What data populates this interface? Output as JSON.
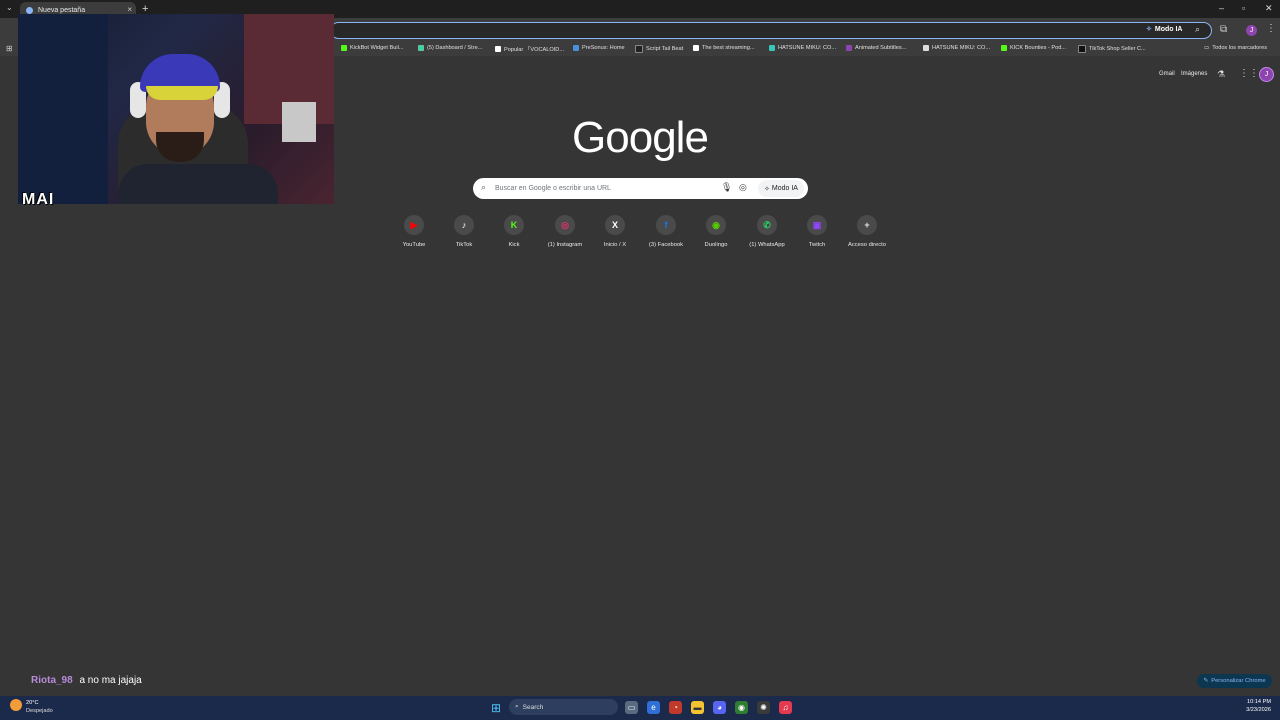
{
  "browser": {
    "tab_title": "Nueva pestaña",
    "new_tab_symbol": "+",
    "close_symbol": "×",
    "modo_ia_label": "Modo IA",
    "profile_initial": "J"
  },
  "bookmarks": [
    {
      "label": "KickBot Widget Buil...",
      "color": "#53fc18"
    },
    {
      "label": "(5) Dashboard / Stre...",
      "color": "#4ecca3"
    },
    {
      "label": "Popular 「VOCALOID...",
      "color": "#ffffff"
    },
    {
      "label": "PreSonus: Home",
      "color": "#4a90d9"
    },
    {
      "label": "Script Tail Beat",
      "color": "#222222"
    },
    {
      "label": "The best streaming...",
      "color": "#ffffff"
    },
    {
      "label": "HATSUNE MIKU: CO...",
      "color": "#39c5bb"
    },
    {
      "label": "Animated Subtitles...",
      "color": "#8e44ad"
    },
    {
      "label": "HATSUNE MIKU: CO...",
      "color": "#dddddd"
    },
    {
      "label": "KICK Bounties - Pod...",
      "color": "#53fc18"
    },
    {
      "label": "TikTok Shop Seller C...",
      "color": "#111111"
    }
  ],
  "all_bookmarks_label": "Todos los marcadores",
  "google": {
    "gmail": "Gmail",
    "imagenes": "Imágenes",
    "logo": "Google",
    "search_placeholder": "Buscar en Google o escribir una URL",
    "modo_ia": "Modo IA"
  },
  "shortcuts": [
    {
      "label": "YouTube",
      "glyph": "▶",
      "color": "#ff0000"
    },
    {
      "label": "TikTok",
      "glyph": "♪",
      "color": "#ffffff"
    },
    {
      "label": "Kick",
      "glyph": "K",
      "color": "#53fc18"
    },
    {
      "label": "(1) Instagram",
      "glyph": "◎",
      "color": "#e1306c"
    },
    {
      "label": "Inicio / X",
      "glyph": "X",
      "color": "#ffffff"
    },
    {
      "label": "(3) Facebook",
      "glyph": "f",
      "color": "#1877f2"
    },
    {
      "label": "Duolingo",
      "glyph": "◉",
      "color": "#58cc02"
    },
    {
      "label": "(1) WhatsApp",
      "glyph": "✆",
      "color": "#25d366"
    },
    {
      "label": "Twitch",
      "glyph": "▣",
      "color": "#9146ff"
    },
    {
      "label": "Acceso directo",
      "glyph": "+",
      "color": "#e8eaed"
    }
  ],
  "stream": {
    "cam_tag": "MAI",
    "chat_user": "Riota_98",
    "chat_message": "a no ma jajaja"
  },
  "customize_label": "Personalizar Chrome",
  "taskbar": {
    "temperature": "20°C",
    "weather": "Despejado",
    "search_label": "Search",
    "time": "10:14 PM",
    "date": "3/23/2026"
  }
}
